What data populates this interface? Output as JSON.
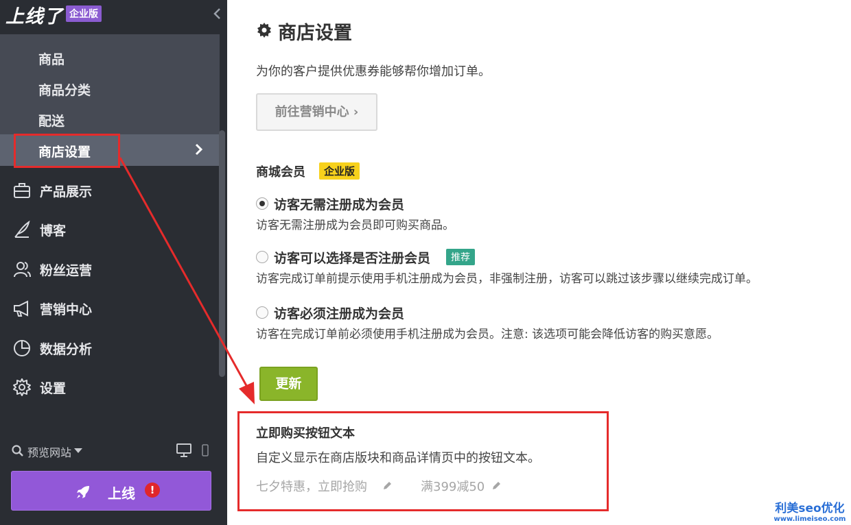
{
  "sidebar": {
    "logo_text": "上线了",
    "edition_badge": "企业版",
    "submenu": [
      "商品",
      "商品分类",
      "配送",
      "商店设置"
    ],
    "menu": [
      {
        "label": "产品展示",
        "icon": "briefcase-icon"
      },
      {
        "label": "博客",
        "icon": "quill-icon"
      },
      {
        "label": "粉丝运营",
        "icon": "users-icon"
      },
      {
        "label": "营销中心",
        "icon": "megaphone-icon"
      },
      {
        "label": "数据分析",
        "icon": "pie-chart-icon"
      },
      {
        "label": "设置",
        "icon": "gear-icon"
      }
    ],
    "preview_label": "预览网站",
    "publish_label": "上线",
    "publish_alert": "!"
  },
  "main": {
    "title": "商店设置",
    "intro": "为你的客户提供优惠券能够帮你增加订单。",
    "goto_button": "前往营销中心 ›",
    "member_title": "商城会员",
    "member_badge": "企业版",
    "options": [
      {
        "label": "访客无需注册成为会员",
        "desc": "访客无需注册成为会员即可购买商品。",
        "checked": true
      },
      {
        "label": "访客可以选择是否注册会员",
        "desc": "访客完成订单前提示使用手机注册成为会员，非强制注册，访客可以跳过该步骤以继续完成订单。",
        "checked": false,
        "badge": "推荐"
      },
      {
        "label": "访客必须注册成为会员",
        "desc": "访客在完成订单前必须使用手机注册成为会员。注意: 该选项可能会降低访客的购买意愿。",
        "checked": false
      }
    ],
    "update_button": "更新",
    "buy_title": "立即购买按钮文本",
    "buy_desc": "自定义显示在商店版块和商品详情页中的按钮文本。",
    "buy_texts": [
      "七夕特惠，立即抢购",
      "满399减50"
    ]
  },
  "watermark": {
    "main": "利美seo优化",
    "url": "www.limeiseo.com"
  },
  "colors": {
    "sidebar": "#2a2d33",
    "accent_purple": "#9258d8",
    "annotation_red": "#e52b2b",
    "update_green": "#8ab52a"
  }
}
